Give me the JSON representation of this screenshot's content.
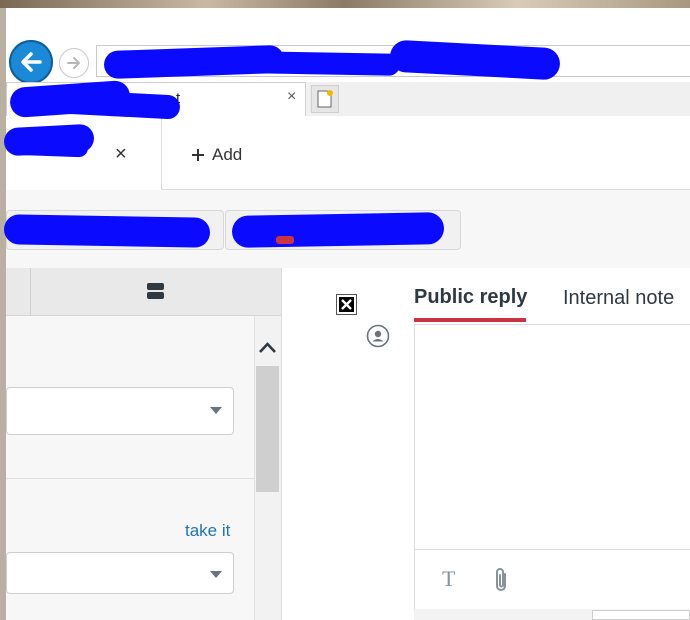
{
  "browser": {
    "address_partial": "//",
    "tab_title_partial": "t",
    "tab_close": "×"
  },
  "app": {
    "tab_close": "×",
    "add_label": "Add",
    "add_icon": "plus-icon"
  },
  "left_panel": {
    "take_it_link": "take it"
  },
  "reply": {
    "tabs": [
      {
        "label": "Public reply",
        "active": true
      },
      {
        "label": "Internal note",
        "active": false
      }
    ],
    "toolbar_text_icon": "T"
  },
  "colors": {
    "back_button": "#1a8ad8",
    "active_tab_underline": "#cc3340",
    "link": "#1f73b7",
    "redaction": "#0a0aff"
  }
}
